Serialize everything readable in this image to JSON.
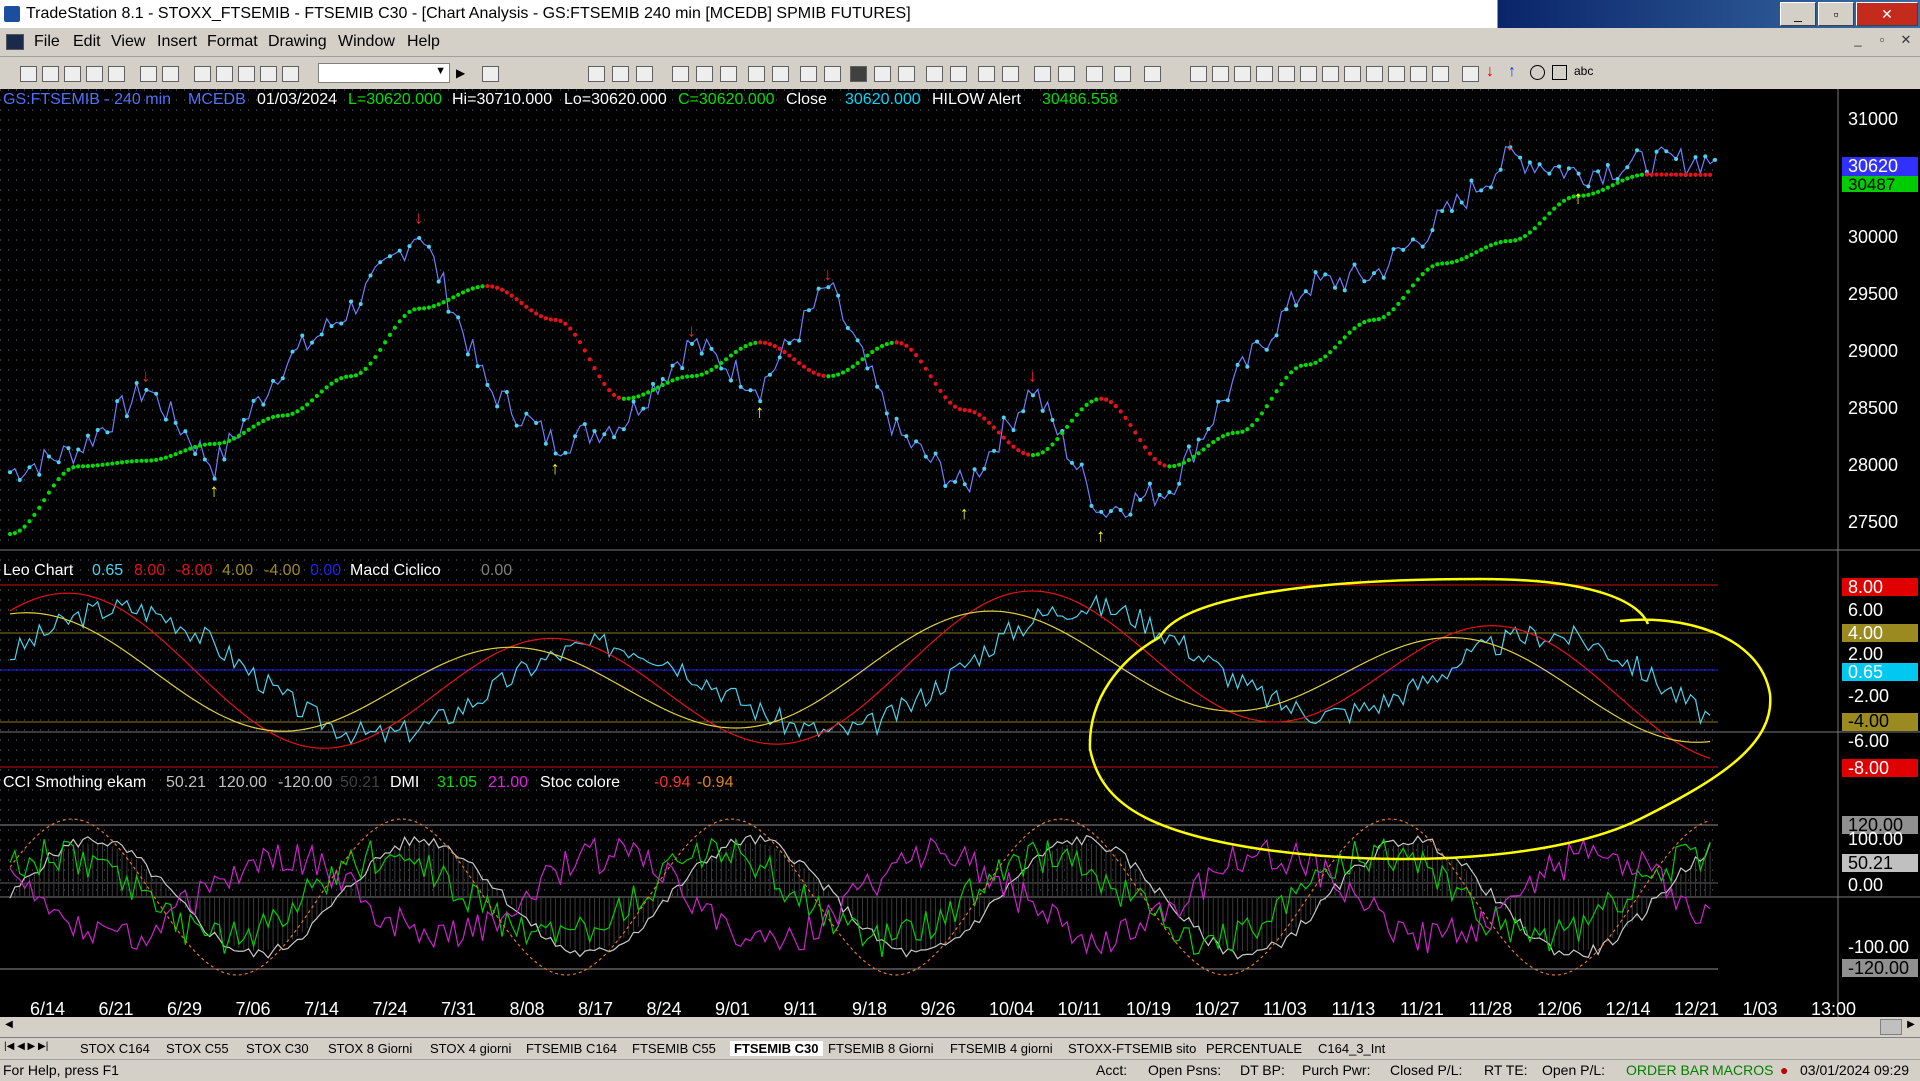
{
  "window": {
    "title": "TradeStation 8.1 - STOXX_FTSEMIB - FTSEMIB C30 - [Chart Analysis - GS:FTSEMIB  240 min  [MCEDB] SPMIB FUTURES]",
    "controls": [
      "_",
      "▫",
      "✕"
    ]
  },
  "menu": [
    "File",
    "Edit",
    "View",
    "Insert",
    "Format",
    "Drawing",
    "Window",
    "Help"
  ],
  "price_pane": {
    "header": {
      "symbol": "GS:FTSEMIB - 240 min",
      "source": "MCEDB",
      "date": "01/03/2024",
      "low_close": "L=30620.000",
      "hi": "Hi=30710.000",
      "lo": "Lo=30620.000",
      "c": "C=30620.000",
      "close_label": "Close",
      "close_value": "30620.000",
      "alert_label": "HILOW Alert",
      "alert_value": "30486.558"
    },
    "axis_ticks": [
      "31000",
      "30000",
      "29500",
      "29000",
      "28500",
      "28000",
      "27500"
    ],
    "last_price": "30620",
    "alert_price": "30487",
    "colors": {
      "price": "#49d3f0",
      "bull": "#00dd00",
      "bear": "#e8101a",
      "up_arrow": "#ffff00",
      "down_arrow": "#ff2020"
    }
  },
  "leo_pane": {
    "header": {
      "name": "Leo Chart",
      "v1": "0.65",
      "v2": "8.00",
      "v3": "-8.00",
      "v4": "4.00",
      "v5": "-4.00",
      "v6": "0.00",
      "macd": "Macd Ciclico",
      "macd_value": "0.00"
    },
    "axis_ticks": [
      "8.00",
      "6.00",
      "4.00",
      "2.00",
      "0.65",
      "-2.00",
      "-4.00",
      "-6.00",
      "-8.00"
    ]
  },
  "cci_pane": {
    "header": {
      "name": "CCI Smothing ekam",
      "v1": "50.21",
      "v2": "120.00",
      "v3": "-120.00",
      "v4": "50.21",
      "dmi": "DMI",
      "dmi1": "31.05",
      "dmi2": "21.00",
      "stoc": "Stoc colore",
      "stoc1": "-0.94",
      "stoc2": "-0.94"
    },
    "axis_ticks": [
      "120.00",
      "100.00",
      "50.21",
      "0.00",
      "-100.00",
      "-120.00"
    ]
  },
  "x_axis": [
    "6/14",
    "6/21",
    "6/29",
    "7/06",
    "7/14",
    "7/24",
    "7/31",
    "8/08",
    "8/17",
    "8/24",
    "9/01",
    "9/11",
    "9/18",
    "9/26",
    "10/04",
    "10/11",
    "10/19",
    "10/27",
    "11/03",
    "11/13",
    "11/21",
    "11/28",
    "12/06",
    "12/14",
    "12/21",
    "1/03",
    "13:00"
  ],
  "tabs": [
    "STOX C164",
    "STOX C55",
    "STOX  C30",
    "STOX  8 Giorni",
    "STOX 4 giorni",
    "FTSEMIB C164",
    "FTSEMIB C55",
    "FTSEMIB C30",
    "FTSEMIB  8 Giorni",
    "FTSEMIB  4 giorni",
    "STOXX-FTSEMIB sito",
    "PERCENTUALE",
    "C164_3_Int"
  ],
  "active_tab": "FTSEMIB C30",
  "status": {
    "help": "For Help, press F1",
    "acct": "Acct:",
    "open_psns": "Open Psns:",
    "dt_bp": "DT BP:",
    "purch_pwr": "Purch Pwr:",
    "closed_pl": "Closed P/L:",
    "rt_te": "RT TE:",
    "open_pl": "Open P/L:",
    "order_bar": "ORDER BAR",
    "macros": "MACROS",
    "datetime": "03/01/2024 09:29"
  },
  "chart_data": {
    "type": "line",
    "x_labels": [
      "6/14",
      "6/21",
      "6/29",
      "7/06",
      "7/14",
      "7/24",
      "7/31",
      "8/08",
      "8/17",
      "8/24",
      "9/01",
      "9/11",
      "9/18",
      "9/26",
      "10/04",
      "10/11",
      "10/19",
      "10/27",
      "11/03",
      "11/13",
      "11/21",
      "11/28",
      "12/06",
      "12/14",
      "12/21",
      "1/03"
    ],
    "price_series": [
      {
        "name": "Close",
        "values": [
          27850,
          28050,
          28600,
          27900,
          28800,
          29300,
          30000,
          28600,
          28100,
          28300,
          29000,
          28600,
          29500,
          28200,
          27700,
          28600,
          27500,
          27700,
          28700,
          29500,
          29600,
          30100,
          30650,
          30500,
          30600,
          30620
        ]
      },
      {
        "name": "HILOW Alert",
        "values": [
          27300,
          27900,
          27950,
          28100,
          28350,
          28700,
          29300,
          29500,
          29200,
          28500,
          28700,
          29000,
          28700,
          29000,
          28400,
          28000,
          28500,
          27900,
          28200,
          28800,
          29200,
          29700,
          29900,
          30300,
          30490,
          30487
        ]
      }
    ],
    "ylim": [
      27300,
      31000
    ]
  }
}
